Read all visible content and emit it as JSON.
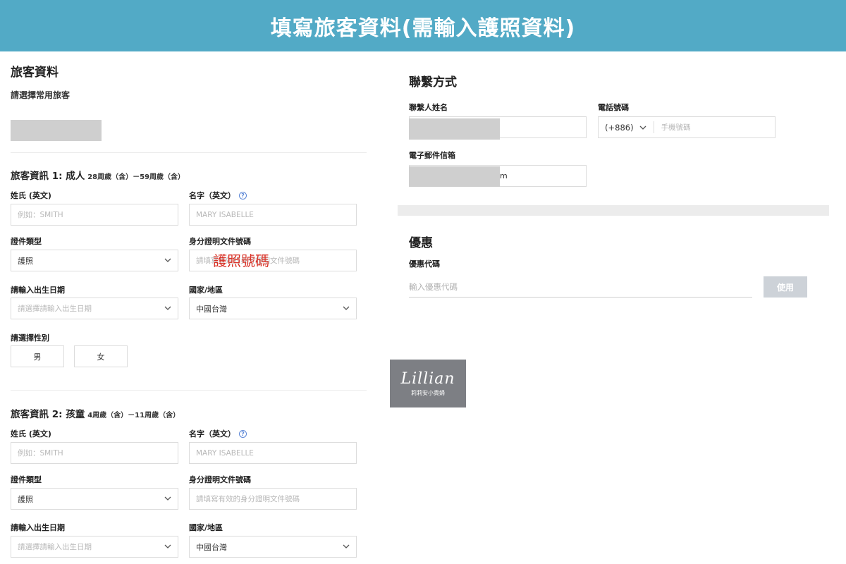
{
  "banner": {
    "title": "填寫旅客資料(需輸入護照資料)"
  },
  "left": {
    "section_title": "旅客資料",
    "choose_frequent": "請選擇常用旅客",
    "travelers": [
      {
        "title": "旅客資訊 1: 成人",
        "age": "28周歲（含）－59周歲（含）",
        "surname_label": "姓氏 (英文)",
        "surname_placeholder": "例如：SMITH",
        "given_label": "名字（英文）",
        "given_placeholder": "MARY ISABELLE",
        "doc_type_label": "證件類型",
        "doc_type_value": "護照",
        "id_label": "身分證明文件號碼",
        "id_placeholder": "請填寫有效的身分證明文件號碼",
        "birth_label": "請輸入出生日期",
        "birth_placeholder": "請選擇請輸入出生日期",
        "country_label": "國家/地區",
        "country_value": "中國台灣",
        "gender_label": "請選擇性別",
        "gender_male": "男",
        "gender_female": "女"
      },
      {
        "title": "旅客資訊 2: 孩童",
        "age": "4周歲（含）－11周歲（含）",
        "surname_label": "姓氏 (英文)",
        "surname_placeholder": "例如：SMITH",
        "given_label": "名字（英文）",
        "given_placeholder": "MARY ISABELLE",
        "doc_type_label": "證件類型",
        "doc_type_value": "護照",
        "id_label": "身分證明文件號碼",
        "id_placeholder": "請填寫有效的身分證明文件號碼",
        "birth_label": "請輸入出生日期",
        "birth_placeholder": "請選擇請輸入出生日期",
        "country_label": "國家/地區",
        "country_value": "中國台灣"
      }
    ],
    "overlay_annotation": "護照號碼"
  },
  "contact": {
    "title": "聯繫方式",
    "name_label": "聯繫人姓名",
    "phone_label": "電話號碼",
    "phone_code": "(+886)",
    "phone_placeholder": "手機號碼",
    "email_label": "電子郵件信箱",
    "email_visible_suffix": "m"
  },
  "coupon": {
    "title": "優惠",
    "code_label": "優惠代碼",
    "code_placeholder": "輸入優惠代碼",
    "apply_label": "使用"
  },
  "watermark": {
    "script": "Lillian",
    "sub": "莉莉安小貴婦"
  },
  "colors": {
    "banner": "#52aac6",
    "annotation": "#d93025",
    "help_icon": "#5b86d6",
    "apply_button": "#cdd2d8"
  }
}
